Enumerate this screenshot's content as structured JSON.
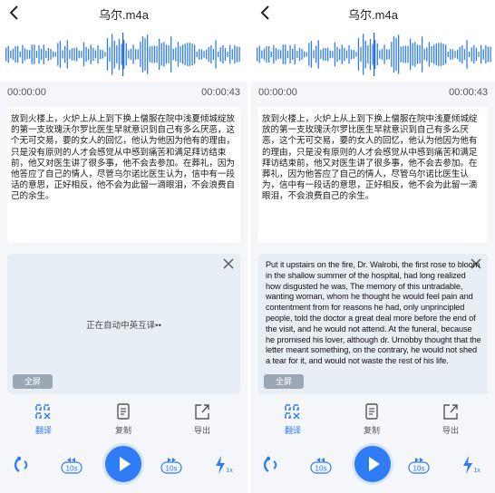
{
  "screens": [
    {
      "title": "乌尔.m4a",
      "time_start": "00:00:00",
      "time_end": "00:00:43",
      "transcript": "放到火楼上，火炉上从上到下换上僧服在院中浅夏倾城绽放的第一支玫瑰沃尔罗比医生早就意识到自己有多么厌恶，这个无可交易，要的女人的回忆，他认为他因为他有的理由，只是没有原则的人才会感觉从中感到痛苦和满足拜访结束前，他又对医生讲了很多事，他不会去参加。在葬礼，因为他答应了自己的情人，尽管乌尔诺比医生认为，信中有一段话的意思，正好相反，他不会为此留一滴眼泪，不会浪费自己的余生。",
      "translation_status": "正在自动中英互译••",
      "translation_text": "",
      "fullscreen_label": "全屏"
    },
    {
      "title": "乌尔.m4a",
      "time_start": "00:00:00",
      "time_end": "00:00:43",
      "transcript": "放到火楼上，火炉上从上到下换上僧服在院中浅夏倾城绽放的第一支玫瑰沃尔罗比医生早就意识到自己有多么厌恶，这个无可交易，要的女人的回忆，他认为他因为他有的理由，只是没有原则的人才会感觉从中感到痛苦和满足拜访结束前，他又对医生讲了很多事，他不会去参加。在葬礼，因为他答应了自己的情人，尽管乌尔诺比医生认为，信中有一段话的意思，正好相反，他不会为此留一滴眼泪，不会浪费自己的余生。",
      "translation_status": "",
      "translation_text": "Put it upstairs on the fire, Dr. Walrobi, the first rose to bloom in the shallow summer of the hospital, had long realized how disgusted he was, The memory of this untradable, wanting woman, whom he thought he would feel pain and contentment from for reasons he had, only unprincipled people, told the doctor a great deal more before the end of the visit, and he would not attend. At the funeral, because he promised his lover, although dr. Urnobby thought that the letter meant something, on the contrary, he would not shed a tear for it, and would not waste the rest of his life.",
      "fullscreen_label": "全屏"
    }
  ],
  "tools": {
    "translate": "翻译",
    "copy": "复制",
    "export": "导出"
  },
  "player": {
    "rewind_label": "10s",
    "forward_label": "10s",
    "speed_label": "1x"
  },
  "colors": {
    "accent": "#2f7cf6",
    "panel": "#e8eef6",
    "background": "#f4f6f9"
  }
}
